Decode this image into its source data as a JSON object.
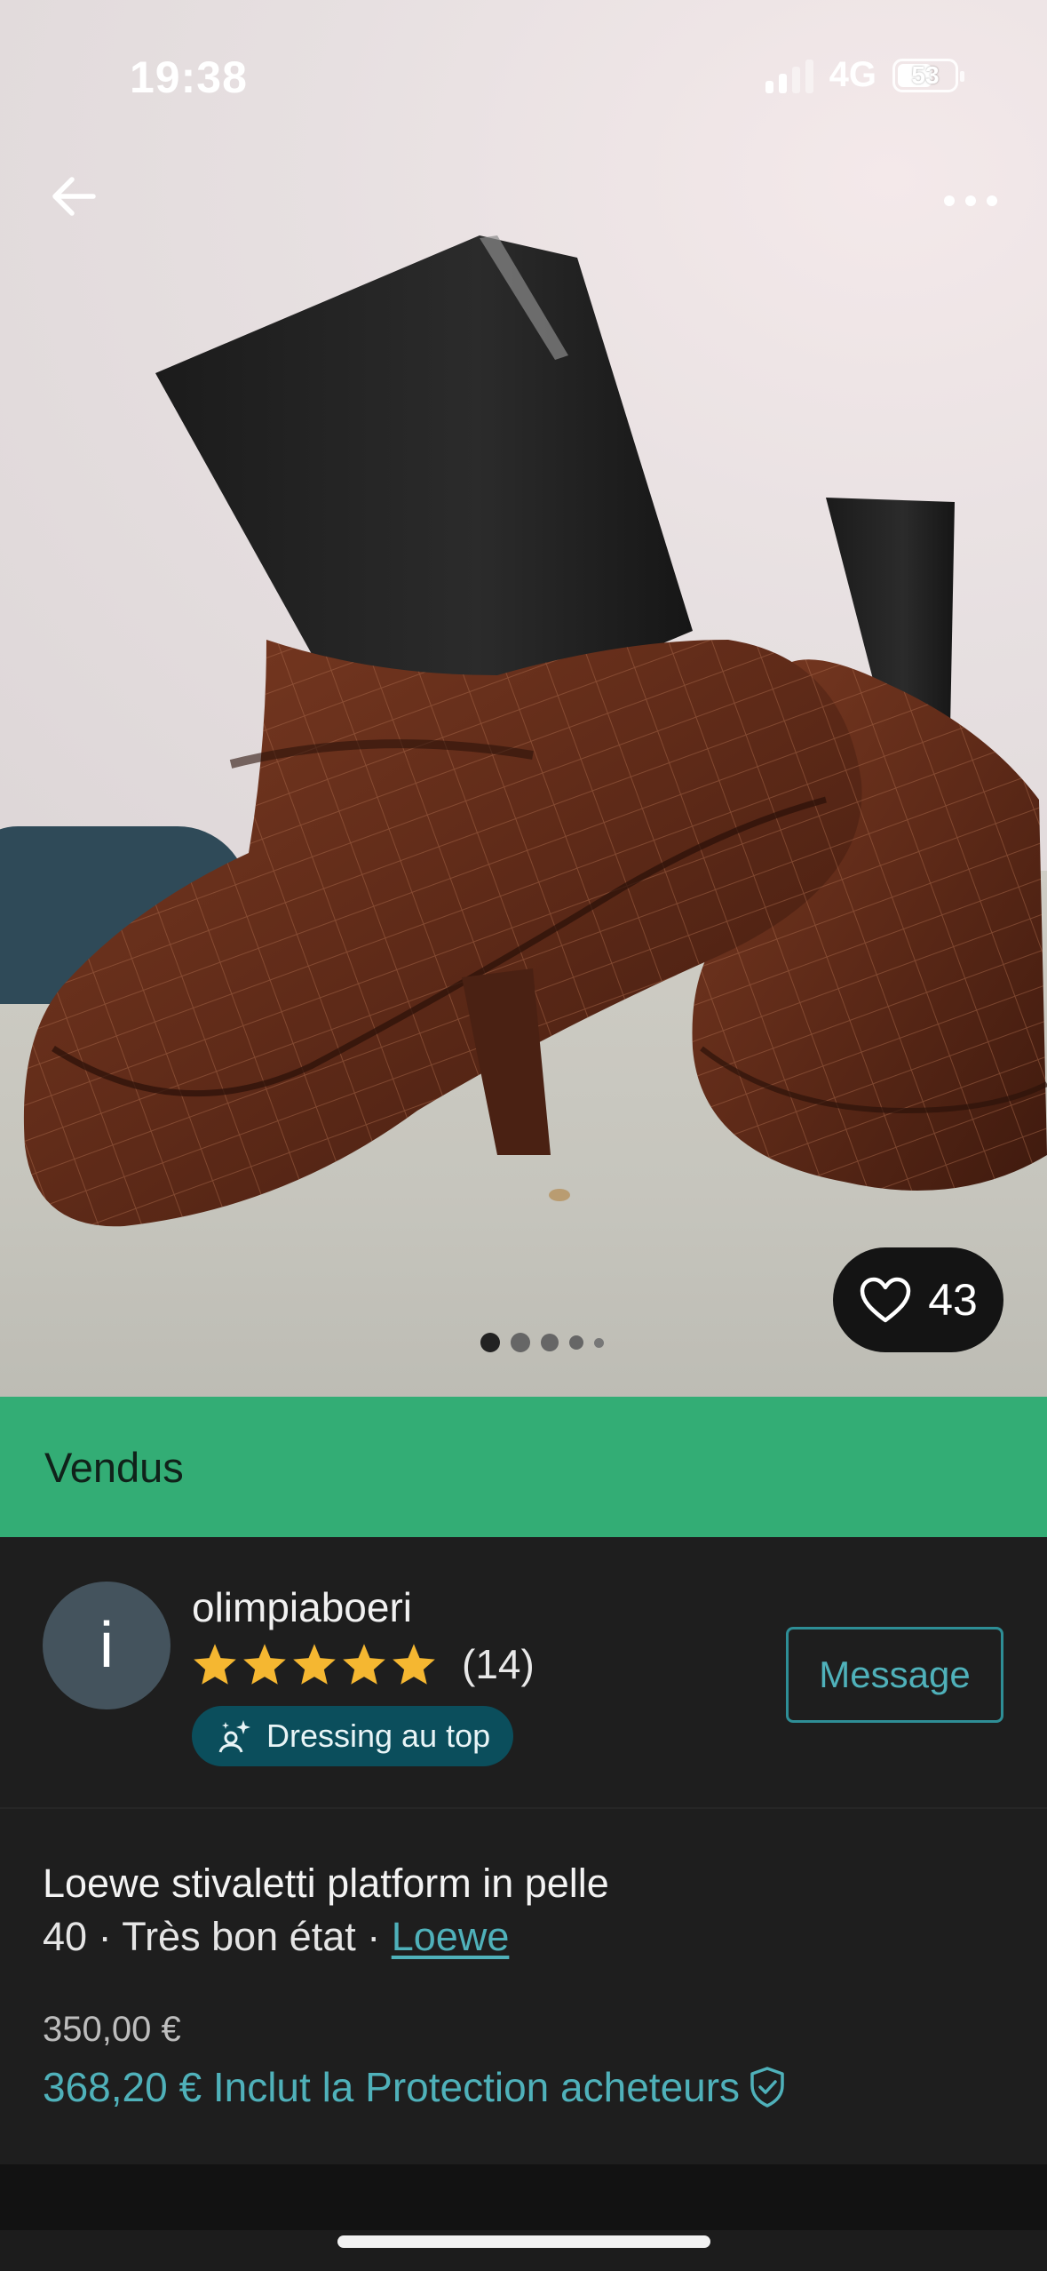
{
  "status_bar": {
    "time": "19:38",
    "network": "4G",
    "battery": "53"
  },
  "colors": {
    "sold_green": "#33ad75",
    "accent_teal": "#4fb1ba",
    "badge_bg": "#0b4e5c",
    "star": "#f5b731"
  },
  "gallery": {
    "likes": "43",
    "page_count": 5,
    "active_index": 0
  },
  "banner": {
    "label": "Vendus"
  },
  "seller": {
    "avatar_initial": "i",
    "username": "olimpiaboeri",
    "rating_stars": 5,
    "reviews": "(14)",
    "badge": "Dressing au top",
    "message_button": "Message"
  },
  "item": {
    "title": "Loewe stivaletti platform in pelle",
    "size": "40",
    "separator": " · ",
    "condition": "Très bon état",
    "brand": "Loewe",
    "price": "350,00 €",
    "total_price": "368,20 € Inclut la Protection acheteurs"
  }
}
